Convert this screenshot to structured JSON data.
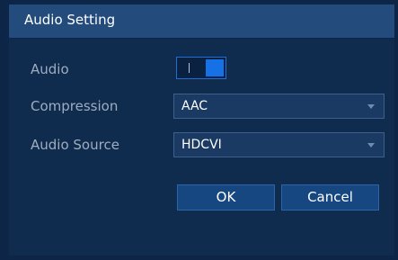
{
  "dialog": {
    "title": "Audio Setting"
  },
  "fields": {
    "audio": {
      "label": "Audio",
      "enabled": true,
      "toggle_on_text": "I"
    },
    "compression": {
      "label": "Compression",
      "value": "AAC"
    },
    "audio_source": {
      "label": "Audio Source",
      "value": "HDCVI"
    }
  },
  "buttons": {
    "ok": "OK",
    "cancel": "Cancel"
  },
  "colors": {
    "background": "#0d2647",
    "titlebar": "#234b7c",
    "accent": "#1670e6",
    "button": "#164781"
  }
}
